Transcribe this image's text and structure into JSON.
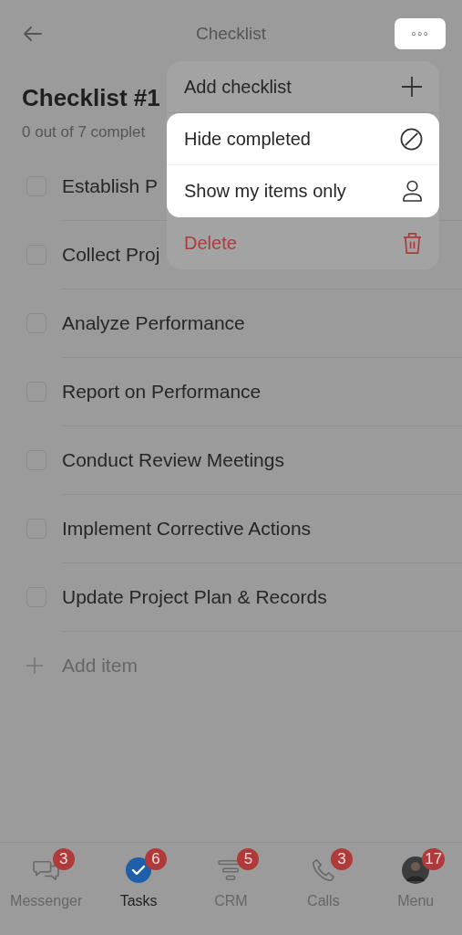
{
  "header": {
    "title": "Checklist",
    "more_button": "◦◦◦"
  },
  "checklist": {
    "title": "Checklist #1",
    "progress": "0 out of 7 complet",
    "items": [
      {
        "text": "Establish P",
        "checked": false
      },
      {
        "text": "Collect Proj",
        "checked": false
      },
      {
        "text": "Analyze Performance",
        "checked": false
      },
      {
        "text": "Report on Performance",
        "checked": false
      },
      {
        "text": "Conduct Review Meetings",
        "checked": false
      },
      {
        "text": "Implement Corrective Actions",
        "checked": false
      },
      {
        "text": "Update Project Plan & Records",
        "checked": false
      }
    ],
    "add_item": "Add item"
  },
  "menu": [
    {
      "label": "Add checklist",
      "kind": "plus",
      "highlighted": false
    },
    {
      "label": "Hide completed",
      "kind": "hide",
      "highlighted": true
    },
    {
      "label": "Show my items only",
      "kind": "person",
      "highlighted": true
    },
    {
      "label": "Delete",
      "kind": "delete",
      "highlighted": false
    }
  ],
  "tabs": [
    {
      "label": "Messenger",
      "kind": "chat",
      "badge": "3",
      "selected": false
    },
    {
      "label": "Tasks",
      "kind": "tasks",
      "badge": "6",
      "selected": true
    },
    {
      "label": "CRM",
      "kind": "crm",
      "badge": "5",
      "selected": false
    },
    {
      "label": "Calls",
      "kind": "calls",
      "badge": "3",
      "selected": false
    },
    {
      "label": "Menu",
      "kind": "avatar",
      "badge": "17",
      "selected": false
    }
  ]
}
